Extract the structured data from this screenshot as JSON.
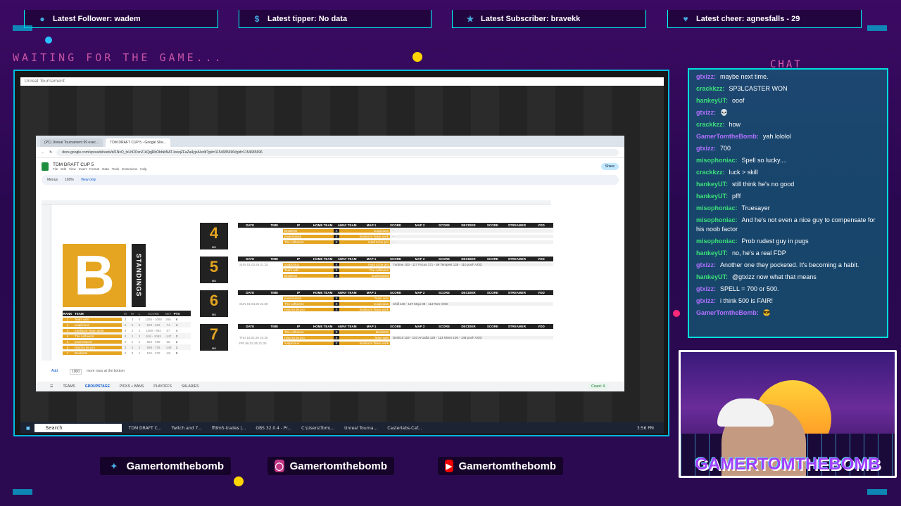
{
  "alerts": [
    {
      "icon": "user-icon",
      "text": "Latest Follower: wadem"
    },
    {
      "icon": "dollar-icon",
      "text": "Latest tipper: No data"
    },
    {
      "icon": "star-icon",
      "text": "Latest Subscriber: bravekk"
    },
    {
      "icon": "heart-icon",
      "text": "Latest cheer: agnesfalls - 29"
    }
  ],
  "overlay": {
    "waiting_text": "WAITING FOR THE GAME...",
    "chat_title": "CHAT"
  },
  "game_window": {
    "title": "Unreal Tournament"
  },
  "browser": {
    "tabs": [
      "(PC) Unreal Tournament 99 exec...",
      "TDM DRAFT CUP 5 - Google She..."
    ],
    "url": "docs.google.com/spreadsheets/d/1NxO_txLhDOxnZ-kQqjRbObbktNAT-kxsqZFaZa4yjxA/edit?gid=1154685696#gid=1154685696",
    "doc_title": "TDM DRAFT CUP 5",
    "menu": [
      "File",
      "Edit",
      "View",
      "Insert",
      "Format",
      "Data",
      "Tools",
      "Extensions",
      "Help"
    ],
    "share_label": "Share",
    "toolbar": {
      "menus": "Menus",
      "zoom": "100%",
      "mode": "View only"
    },
    "standings_logo": "B",
    "standings_label": "STANDINGS",
    "standings_headers": [
      "RANK",
      "TEAM",
      "M",
      "W",
      "L",
      "SCORE",
      "NET",
      "PTS"
    ],
    "standings": [
      {
        "rank": "1",
        "team": "Team wdv",
        "m": "3",
        "w": "3",
        "l": "0",
        "score": "1255 - 1080",
        "net": "265",
        "pts": "6"
      },
      {
        "rank": "2",
        "team": "suspicious",
        "m": "2",
        "w": "2",
        "l": "0",
        "score": "523 - 452",
        "net": "71",
        "pts": "4"
      },
      {
        "rank": "3",
        "team": "mediocre Team work",
        "m": "3",
        "w": "2",
        "l": "1",
        "score": "1060 - 992",
        "net": "67",
        "pts": "4"
      },
      {
        "rank": "4",
        "team": "The Leftovers",
        "m": "3",
        "w": "1",
        "l": "2",
        "score": "916 - 1063",
        "net": "-147",
        "pts": "3"
      },
      {
        "rank": "5",
        "team": "powersaved",
        "m": "2",
        "w": "1",
        "l": "1",
        "score": "554 - 489",
        "net": "65",
        "pts": "2"
      },
      {
        "rank": "6",
        "team": "Hard to be pro",
        "m": "3",
        "w": "0",
        "l": "2",
        "score": "588 - 736",
        "net": "-148",
        "pts": "1"
      },
      {
        "rank": "7",
        "team": "Brodents",
        "m": "2",
        "w": "0",
        "l": "1",
        "score": "192 - 275",
        "net": "-83",
        "pts": "0"
      }
    ],
    "match_headers": [
      "DATE",
      "TIME",
      "IP",
      "HOME TEAM",
      "AWAY TEAM",
      "MAP 1",
      "SCORE",
      "MAP 2",
      "SCORE",
      "DECIDER",
      "SCORE",
      "STREAMER",
      "VOD"
    ],
    "weeks": [
      {
        "num": "4",
        "md": "MD",
        "matches": [
          {
            "date": "",
            "home": "Brodents",
            "away": "suspicious",
            "rest": "-"
          },
          {
            "date": "",
            "home": "powersaved",
            "away": "mediocre Team work",
            "rest": "-"
          },
          {
            "date": "",
            "home": "The Leftovers",
            "away": "Hard to be pro",
            "rest": "-"
          }
        ]
      },
      {
        "num": "5",
        "md": "MD",
        "matches": [
          {
            "date": "SUN 01.03.26 21:15",
            "home": "suspicious",
            "away": "Hard to be pro",
            "rest": "Turbine 103 - 117 Focus 171 - 59 Tempest 135 - 110 pooh VOD"
          },
          {
            "date": "",
            "home": "Team wdv",
            "away": "The Leftovers",
            "rest": ""
          },
          {
            "date": "",
            "home": "Brodents",
            "away": "powersaved",
            "rest": ""
          }
        ]
      },
      {
        "num": "6",
        "md": "MD",
        "matches": [
          {
            "date": "",
            "home": "powersaved",
            "away": "Team wdv",
            "rest": ""
          },
          {
            "date": "SUN 01.03.26 21:30",
            "home": "The Leftovers",
            "away": "suspicious",
            "rest": "Chill 130 - 137 Mojo 88 - 113 Tom VOD"
          },
          {
            "date": "",
            "home": "Hard to be pro",
            "away": "mediocre Team work",
            "rest": ""
          }
        ]
      },
      {
        "num": "7",
        "md": "MD",
        "matches": [
          {
            "date": "",
            "home": "The Leftovers",
            "away": "Brodents",
            "rest": ""
          },
          {
            "date": "THU 18.02.26 22:30",
            "home": "Hard to be pro",
            "away": "Team wdv",
            "rest": "Deck16 118 - 153 Arcadia 129 - 113 Niven 105 - 148 pooh VOD"
          },
          {
            "date": "FRI 06.03.26 21:30",
            "home": "suspicious",
            "away": "mediocre Team work",
            "rest": ""
          }
        ]
      }
    ],
    "sheet_tabs": [
      "TEAMS",
      "GROUPSTAGE",
      "PICKS + BANS",
      "PLAYOFFS",
      "SALARIES"
    ],
    "active_sheet": "GROUPSTAGE",
    "count": "Count: 4",
    "add_label": "Add",
    "add_rows": "1000",
    "add_suffix": "more rows at the bottom"
  },
  "taskbar": {
    "search": "Search",
    "tasks": [
      "TDM DRAFT C...",
      "Twitch and 7...",
      "ffdm5-trades |...",
      "OBS 32.0.4 - Pr...",
      "C:\\Users\\Tom\\...",
      "Unreal Tourna...",
      "Casterlabs-Caf..."
    ],
    "clock": "3:56 PM"
  },
  "chat": [
    {
      "user": "gtxizz",
      "color": "#b070ff",
      "text": "maybe next time."
    },
    {
      "user": "crackkzz",
      "color": "#3be07a",
      "text": "SP3LCASTER WON"
    },
    {
      "user": "hankeyUT",
      "color": "#3be07a",
      "text": "ooof"
    },
    {
      "user": "gtxizz",
      "color": "#b070ff",
      "text": "💀"
    },
    {
      "user": "crackkzz",
      "color": "#3be07a",
      "text": "how"
    },
    {
      "user": "GamerTomtheBomb",
      "color": "#b070ff",
      "text": "yah lololol"
    },
    {
      "user": "gtxizz",
      "color": "#b070ff",
      "text": "700"
    },
    {
      "user": "misophoniac",
      "color": "#3be07a",
      "text": "Spell so lucky...."
    },
    {
      "user": "crackkzz",
      "color": "#3be07a",
      "text": "luck > skill"
    },
    {
      "user": "hankeyUT",
      "color": "#3be07a",
      "text": "still think he's no good"
    },
    {
      "user": "hankeyUT",
      "color": "#3be07a",
      "text": "pfff"
    },
    {
      "user": "misophoniac",
      "color": "#3be07a",
      "text": "Truesayer"
    },
    {
      "user": "misophoniac",
      "color": "#3be07a",
      "text": "And he's not even a nice guy to compensate for his noob factor"
    },
    {
      "user": "misophoniac",
      "color": "#3be07a",
      "text": "Prob rudest guy in pugs"
    },
    {
      "user": "hankeyUT",
      "color": "#3be07a",
      "text": "no, he's a real FDP"
    },
    {
      "user": "gtxizz",
      "color": "#b070ff",
      "text": "Another one they pocketed. It's becoming a habit."
    },
    {
      "user": "hankeyUT",
      "color": "#3be07a",
      "text": "@gtxizz now what that means"
    },
    {
      "user": "gtxizz",
      "color": "#b070ff",
      "text": "SPELL = 700 or 500."
    },
    {
      "user": "gtxizz",
      "color": "#b070ff",
      "text": "i think 500 is FAIR!"
    },
    {
      "user": "GamerTomtheBomb",
      "color": "#b070ff",
      "text": "😎"
    }
  ],
  "webcam": {
    "name": "GAMERTOMTHEBOMB"
  },
  "socials": [
    {
      "platform": "twitter-icon",
      "handle": "Gamertomthebomb"
    },
    {
      "platform": "instagram-icon",
      "handle": "Gamertomthebomb"
    },
    {
      "platform": "youtube-icon",
      "handle": "Gamertomthebomb"
    }
  ]
}
